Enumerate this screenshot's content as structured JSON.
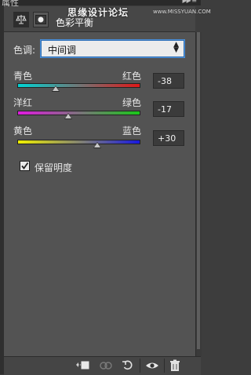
{
  "panel": {
    "title": "属性"
  },
  "watermark": {
    "text": "思缘设计论坛",
    "url": "www.MISSYUAN.COM"
  },
  "adjustment": {
    "title": "色彩平衡",
    "icons": [
      "balance-scale-icon",
      "mask-icon"
    ]
  },
  "tone": {
    "label": "色调:",
    "selected": "中间调"
  },
  "sliders": [
    {
      "left": "青色",
      "right": "红色",
      "value": "-38",
      "level": -38
    },
    {
      "left": "洋红",
      "right": "绿色",
      "value": "-17",
      "level": -17
    },
    {
      "left": "黄色",
      "right": "蓝色",
      "value": "+30",
      "level": 30
    }
  ],
  "preserve": {
    "label": "保留明度",
    "checked": true
  },
  "colors": {
    "accent": "#4d90d8",
    "panel": "#535353"
  },
  "footer": {
    "icons": [
      "clip-to-layer-icon",
      "view-previous-state-icon",
      "reset-icon",
      "visibility-eye-icon",
      "trash-icon"
    ]
  }
}
